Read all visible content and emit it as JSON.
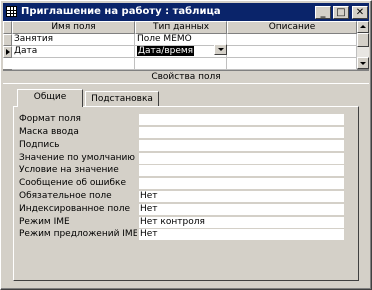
{
  "window": {
    "title": "Приглашение на работу : таблица"
  },
  "grid": {
    "columns": [
      "Имя поля",
      "Тип данных",
      "Описание"
    ],
    "rows": [
      {
        "name": "Занятия",
        "type": "Поле MEMO",
        "description": ""
      },
      {
        "name": "Дата",
        "type": "Дата/время",
        "description": ""
      }
    ]
  },
  "properties": {
    "section_title": "Свойства поля",
    "tabs": [
      "Общие",
      "Подстановка"
    ],
    "fields": [
      {
        "label": "Формат поля",
        "value": ""
      },
      {
        "label": "Маска ввода",
        "value": ""
      },
      {
        "label": "Подпись",
        "value": ""
      },
      {
        "label": "Значение по умолчанию",
        "value": ""
      },
      {
        "label": "Условие на значение",
        "value": ""
      },
      {
        "label": "Сообщение об ошибке",
        "value": ""
      },
      {
        "label": "Обязательное поле",
        "value": "Нет"
      },
      {
        "label": "Индексированное поле",
        "value": "Нет"
      },
      {
        "label": "Режим IME",
        "value": "Нет контроля"
      },
      {
        "label": "Режим предложений IME",
        "value": "Нет"
      }
    ]
  },
  "colors": {
    "title_bar": "#0a246a",
    "face": "#d4d0c8",
    "selection": "#000000"
  }
}
